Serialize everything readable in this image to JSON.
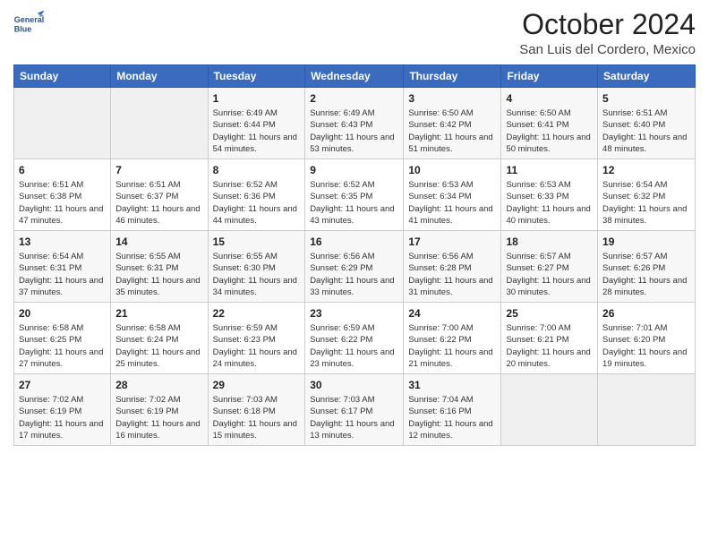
{
  "logo": {
    "line1": "General",
    "line2": "Blue"
  },
  "title": "October 2024",
  "location": "San Luis del Cordero, Mexico",
  "weekdays": [
    "Sunday",
    "Monday",
    "Tuesday",
    "Wednesday",
    "Thursday",
    "Friday",
    "Saturday"
  ],
  "weeks": [
    [
      {
        "day": "",
        "info": ""
      },
      {
        "day": "",
        "info": ""
      },
      {
        "day": "1",
        "info": "Sunrise: 6:49 AM\nSunset: 6:44 PM\nDaylight: 11 hours and 54 minutes."
      },
      {
        "day": "2",
        "info": "Sunrise: 6:49 AM\nSunset: 6:43 PM\nDaylight: 11 hours and 53 minutes."
      },
      {
        "day": "3",
        "info": "Sunrise: 6:50 AM\nSunset: 6:42 PM\nDaylight: 11 hours and 51 minutes."
      },
      {
        "day": "4",
        "info": "Sunrise: 6:50 AM\nSunset: 6:41 PM\nDaylight: 11 hours and 50 minutes."
      },
      {
        "day": "5",
        "info": "Sunrise: 6:51 AM\nSunset: 6:40 PM\nDaylight: 11 hours and 48 minutes."
      }
    ],
    [
      {
        "day": "6",
        "info": "Sunrise: 6:51 AM\nSunset: 6:38 PM\nDaylight: 11 hours and 47 minutes."
      },
      {
        "day": "7",
        "info": "Sunrise: 6:51 AM\nSunset: 6:37 PM\nDaylight: 11 hours and 46 minutes."
      },
      {
        "day": "8",
        "info": "Sunrise: 6:52 AM\nSunset: 6:36 PM\nDaylight: 11 hours and 44 minutes."
      },
      {
        "day": "9",
        "info": "Sunrise: 6:52 AM\nSunset: 6:35 PM\nDaylight: 11 hours and 43 minutes."
      },
      {
        "day": "10",
        "info": "Sunrise: 6:53 AM\nSunset: 6:34 PM\nDaylight: 11 hours and 41 minutes."
      },
      {
        "day": "11",
        "info": "Sunrise: 6:53 AM\nSunset: 6:33 PM\nDaylight: 11 hours and 40 minutes."
      },
      {
        "day": "12",
        "info": "Sunrise: 6:54 AM\nSunset: 6:32 PM\nDaylight: 11 hours and 38 minutes."
      }
    ],
    [
      {
        "day": "13",
        "info": "Sunrise: 6:54 AM\nSunset: 6:31 PM\nDaylight: 11 hours and 37 minutes."
      },
      {
        "day": "14",
        "info": "Sunrise: 6:55 AM\nSunset: 6:31 PM\nDaylight: 11 hours and 35 minutes."
      },
      {
        "day": "15",
        "info": "Sunrise: 6:55 AM\nSunset: 6:30 PM\nDaylight: 11 hours and 34 minutes."
      },
      {
        "day": "16",
        "info": "Sunrise: 6:56 AM\nSunset: 6:29 PM\nDaylight: 11 hours and 33 minutes."
      },
      {
        "day": "17",
        "info": "Sunrise: 6:56 AM\nSunset: 6:28 PM\nDaylight: 11 hours and 31 minutes."
      },
      {
        "day": "18",
        "info": "Sunrise: 6:57 AM\nSunset: 6:27 PM\nDaylight: 11 hours and 30 minutes."
      },
      {
        "day": "19",
        "info": "Sunrise: 6:57 AM\nSunset: 6:26 PM\nDaylight: 11 hours and 28 minutes."
      }
    ],
    [
      {
        "day": "20",
        "info": "Sunrise: 6:58 AM\nSunset: 6:25 PM\nDaylight: 11 hours and 27 minutes."
      },
      {
        "day": "21",
        "info": "Sunrise: 6:58 AM\nSunset: 6:24 PM\nDaylight: 11 hours and 25 minutes."
      },
      {
        "day": "22",
        "info": "Sunrise: 6:59 AM\nSunset: 6:23 PM\nDaylight: 11 hours and 24 minutes."
      },
      {
        "day": "23",
        "info": "Sunrise: 6:59 AM\nSunset: 6:22 PM\nDaylight: 11 hours and 23 minutes."
      },
      {
        "day": "24",
        "info": "Sunrise: 7:00 AM\nSunset: 6:22 PM\nDaylight: 11 hours and 21 minutes."
      },
      {
        "day": "25",
        "info": "Sunrise: 7:00 AM\nSunset: 6:21 PM\nDaylight: 11 hours and 20 minutes."
      },
      {
        "day": "26",
        "info": "Sunrise: 7:01 AM\nSunset: 6:20 PM\nDaylight: 11 hours and 19 minutes."
      }
    ],
    [
      {
        "day": "27",
        "info": "Sunrise: 7:02 AM\nSunset: 6:19 PM\nDaylight: 11 hours and 17 minutes."
      },
      {
        "day": "28",
        "info": "Sunrise: 7:02 AM\nSunset: 6:19 PM\nDaylight: 11 hours and 16 minutes."
      },
      {
        "day": "29",
        "info": "Sunrise: 7:03 AM\nSunset: 6:18 PM\nDaylight: 11 hours and 15 minutes."
      },
      {
        "day": "30",
        "info": "Sunrise: 7:03 AM\nSunset: 6:17 PM\nDaylight: 11 hours and 13 minutes."
      },
      {
        "day": "31",
        "info": "Sunrise: 7:04 AM\nSunset: 6:16 PM\nDaylight: 11 hours and 12 minutes."
      },
      {
        "day": "",
        "info": ""
      },
      {
        "day": "",
        "info": ""
      }
    ]
  ]
}
